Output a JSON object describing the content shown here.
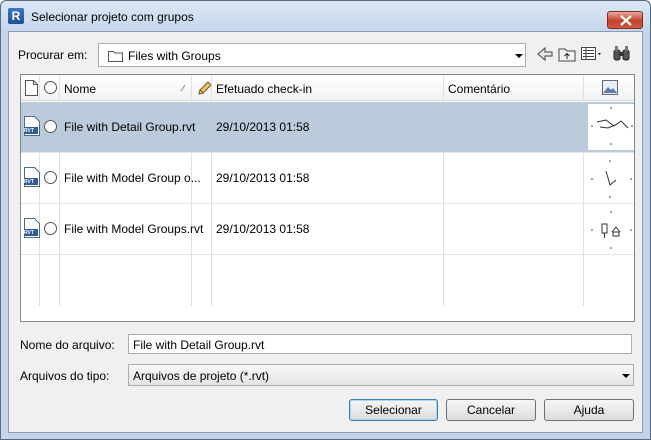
{
  "window": {
    "title": "Selecionar projeto com grupos"
  },
  "look_in": {
    "label": "Procurar em:",
    "value": "Files with Groups"
  },
  "grid": {
    "columns": {
      "name": "Nome",
      "checkin": "Efetuado check-in",
      "comment": "Comentário"
    },
    "rows": [
      {
        "badge": "RVT",
        "name": "File with Detail Group.rvt",
        "checkin": "29/10/2013 01:58",
        "comment": "",
        "selected": true
      },
      {
        "badge": "RVT",
        "name": "File with Model Group o...",
        "checkin": "29/10/2013 01:58",
        "comment": "",
        "selected": false
      },
      {
        "badge": "RVT",
        "name": "File with Model Groups.rvt",
        "checkin": "29/10/2013 01:58",
        "comment": "",
        "selected": false
      }
    ]
  },
  "file_name": {
    "label": "Nome do arquivo:",
    "value": "File with Detail Group.rvt"
  },
  "file_type": {
    "label": "Arquivos do tipo:",
    "value": "Arquivos de projeto (*.rvt)"
  },
  "buttons": {
    "open": "Selecionar",
    "cancel": "Cancelar",
    "help": "Ajuda"
  },
  "colors": {
    "selected_row": "#bccbdb",
    "window_frame": "#c4d5e9",
    "close_button": "#c7402a"
  },
  "icons": [
    "revit-app-icon",
    "close-icon",
    "folder-icon",
    "back-icon",
    "up-folder-icon",
    "views-icon",
    "search-icon",
    "document-icon",
    "pencil-icon",
    "image-icon",
    "rvt-file-icon"
  ]
}
